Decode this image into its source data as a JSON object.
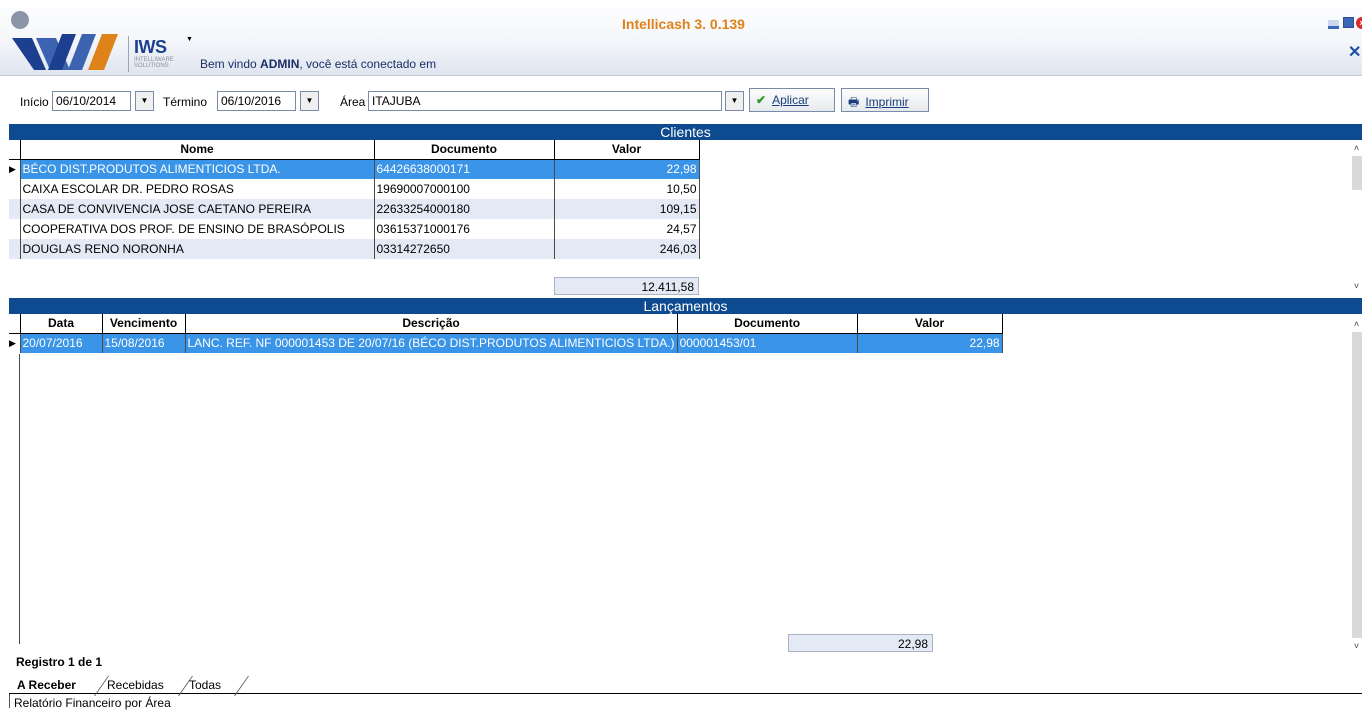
{
  "header": {
    "app_title": "Intellicash 3. 0.139",
    "logo_text": "IWS",
    "logo_sub": "INTELLIWARE SOLUTIONS",
    "welcome_prefix": "Bem vindo ",
    "welcome_user": "ADMIN",
    "welcome_suffix": ", você está conectado em"
  },
  "toolbar": {
    "inicio_label": "Início",
    "inicio_value": "06/10/2014",
    "termino_label": "Término",
    "termino_value": "06/10/2016",
    "area_label": "Área",
    "area_value": "ITAJUBA",
    "aplicar_label": "Aplicar",
    "imprimir_label": "Imprimir"
  },
  "clientes": {
    "title": "Clientes",
    "columns": [
      "Nome",
      "Documento",
      "Valor"
    ],
    "rows": [
      {
        "nome": "BÉCO DIST.PRODUTOS ALIMENTICIOS LTDA.",
        "documento": "64426638000171",
        "valor": "22,98"
      },
      {
        "nome": "CAIXA ESCOLAR DR. PEDRO ROSAS",
        "documento": "19690007000100",
        "valor": "10,50"
      },
      {
        "nome": "CASA DE CONVIVENCIA JOSE CAETANO PEREIRA",
        "documento": "22633254000180",
        "valor": "109,15"
      },
      {
        "nome": "COOPERATIVA DOS PROF. DE ENSINO DE BRASÓPOLIS",
        "documento": "03615371000176",
        "valor": "24,57"
      },
      {
        "nome": "DOUGLAS RENO NORONHA",
        "documento": "03314272650",
        "valor": "246,03"
      }
    ],
    "total": "12.411,58"
  },
  "lancamentos": {
    "title": "Lançamentos",
    "columns": [
      "Data",
      "Vencimento",
      "Descrição",
      "Documento",
      "Valor"
    ],
    "rows": [
      {
        "data": "20/07/2016",
        "vencimento": "15/08/2016",
        "descricao": "LANC. REF. NF 000001453 DE 20/07/16 (BÉCO DIST.PRODUTOS ALIMENTICIOS LTDA.)",
        "documento": "000001453/01",
        "valor": "22,98"
      }
    ],
    "total": "22,98"
  },
  "footer": {
    "registro": "Registro 1 de 1",
    "tabs": [
      "A Receber",
      "Recebidas",
      "Todas"
    ],
    "bottom_tab": "Relatório Financeiro por Área"
  }
}
